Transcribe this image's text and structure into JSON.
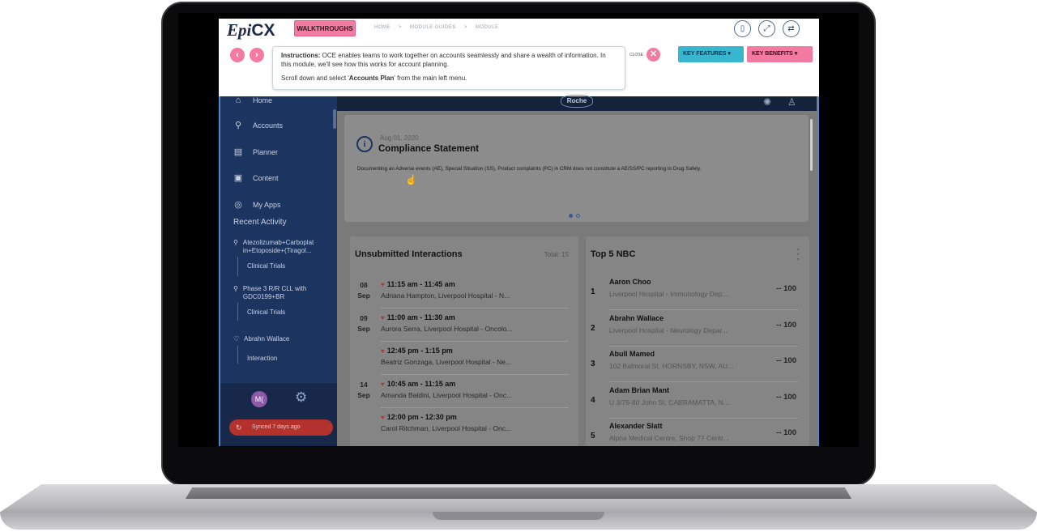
{
  "topbar": {
    "brand_prefix": "Epi",
    "brand_suffix": "CX",
    "walkthroughs_label": "WALKTHROUGHS",
    "breadcrumbs": [
      "HOME",
      ">",
      "MODULE GUIDES",
      ">",
      "MODULE"
    ],
    "instructions_heading": "Instructions:",
    "instructions_line1": " OCE enables teams to work together on accounts seamlessly and share a wealth of information. In this module, we'll see how this works for account planning.",
    "instructions_line2_pre": "Scroll down and select '",
    "instructions_line2_bold": "Accounts Plan",
    "instructions_line2_post": "' from the main left menu.",
    "close_label": "CLOSE",
    "key_features_label": "KEY FEATURES",
    "key_benefits_label": "KEY BENEFITS",
    "prev_glyph": "‹",
    "next_glyph": "›"
  },
  "sidebar": {
    "items": [
      {
        "label": "Home",
        "icon": "home-icon"
      },
      {
        "label": "Accounts",
        "icon": "accounts-icon"
      },
      {
        "label": "Planner",
        "icon": "calendar-icon"
      },
      {
        "label": "Content",
        "icon": "presentation-icon"
      },
      {
        "label": "My Apps",
        "icon": "apps-icon"
      }
    ],
    "recent_heading": "Recent Activity",
    "recent": [
      {
        "title_1": "Atezolizumab+Carboplat",
        "title_2": "in+Etoposide+(Tiragol...",
        "sub": "Clinical Trials"
      },
      {
        "title_1": "Phase 3 R/R CLL with",
        "title_2": "GDC0199+BR",
        "sub": "Clinical Trials"
      },
      {
        "title_1": "Abrahn Wallace",
        "title_2": "",
        "sub": "Interaction"
      }
    ],
    "avatar_initials": "M(",
    "synced_label": "Synced 7 days ago"
  },
  "header": {
    "logo_text": "Roche"
  },
  "compliance": {
    "date": "Aug 01, 2020",
    "title": "Compliance Statement",
    "text": "Documenting an Adverse events (AE), Special Situation (SS), Product complaints (PC) in CRM does not constitute a AE/SS/PC reporting to Drug Safety."
  },
  "unsubmitted": {
    "title": "Unsubmitted Interactions",
    "total": "Total: 15",
    "rows": [
      {
        "day": "08",
        "month": "Sep",
        "time": "11:15 am - 11:45 am",
        "desc": "Adriana Hampton, Liverpool Hospital - N..."
      },
      {
        "day": "09",
        "month": "Sep",
        "time": "11:00 am - 11:30 am",
        "desc": "Aurora Serra, Liverpool Hospital - Oncolo..."
      },
      {
        "day": "",
        "month": "",
        "time": "12:45 pm - 1:15 pm",
        "desc": "Beatriz Gonzaga, Liverpool Hospital - Ne..."
      },
      {
        "day": "14",
        "month": "Sep",
        "time": "10:45 am - 11:15 am",
        "desc": "Amanda Baldini, Liverpool Hospital - Onc..."
      },
      {
        "day": "",
        "month": "",
        "time": "12:00 pm - 12:30 pm",
        "desc": "Carol Ritchman, Liverpool Hospital - Onc..."
      }
    ]
  },
  "nbc": {
    "title": "Top 5 NBC",
    "rows": [
      {
        "rank": "1",
        "name": "Aaron Choo",
        "sub": "Liverpool Hospital - Immunology Dep...",
        "score": "-- 100"
      },
      {
        "rank": "2",
        "name": "Abrahn Wallace",
        "sub": "Liverpool Hospital - Neurology Depar...",
        "score": "-- 100"
      },
      {
        "rank": "3",
        "name": "Abull Mamed",
        "sub": "102 Balmoral St, HORNSBY, NSW, AU...",
        "score": "-- 100"
      },
      {
        "rank": "4",
        "name": "Adam Brian Mant",
        "sub": "U 3/76-80 John St, CABRAMATTA, N...",
        "score": "-- 100"
      },
      {
        "rank": "5",
        "name": "Alexander Slatt",
        "sub": "Alpha Medical Centre, Shop 77 Centr...",
        "score": "-- 100"
      }
    ]
  }
}
